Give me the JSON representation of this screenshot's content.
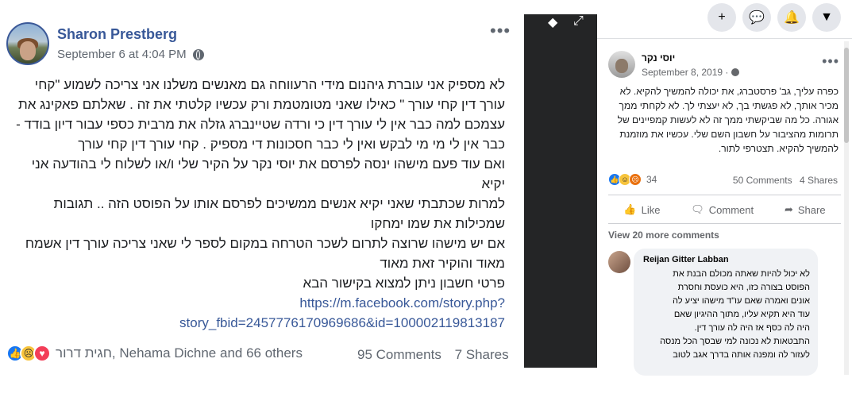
{
  "left_post": {
    "author": "Sharon Prestberg",
    "timestamp": "September 6 at 4:04 PM",
    "more_label": "•••",
    "lines": [
      "לא מספיק אני עוברת גיהנום מידי הרעווחה גם מאנשים משלנו אני צריכה לשמוע \"קחי",
      "עורך דין קחי עורך \" כאילו שאני מטומטמת ורק עכשיו קלטתי את זה . שאלתם פאקינג את",
      "עצמכם למה כבר אין לי עורך דין כי ורדה שטיינברג גזלה את מרבית כספי עבור דיון בודד -",
      "כבר אין לי מי מי לבקש ואין לי כבר חסכונות די מספיק . קחי עורך דין קחי עורך",
      "ואם עוד פעם מישהו ינסה לפרסם את יוסי נקר על הקיר שלי ו/או לשלוח לי בהודעה אני",
      "יקיא",
      "למרות שכתבתי שאני יקיא אנשים ממשיכים לפרסם אותו על הפוסט הזה .. תגובות",
      "שמכילות את שמו ימחקו",
      "אם יש מישהו שרוצה לתרום לשכר הטרחה במקום לספר לי שאני צריכה עורך דין אשמח",
      "מאוד והוקיר זאת מאוד",
      "פרטי חשבון ניתן למצוא בקישור הבא"
    ],
    "link_line1": "https://m.facebook.com/story.php?",
    "link_line2": "story_fbid=2457776170969686&id=100002119813187",
    "reaction_names": "חגית דרור, Nehama Dichne and 66 others",
    "comments": "95 Comments",
    "shares": "7 Shares"
  },
  "top_icons": [
    "plus-icon",
    "messenger-icon",
    "bell-icon",
    "caret-down-icon"
  ],
  "right_post": {
    "author": "יוסי נקר",
    "timestamp": "September 8, 2019 ·",
    "more_label": "•••",
    "lines": [
      "כפרה עליך, גב' פרסטברג, את יכולה להמשיך להקיא. לא",
      "מכיר אותך, לא פגשתי בך, לא יעצתי לך. לא לקחתי ממך",
      "אגורה. כל מה שביקשתי ממך זה לא לעשות קמפיינים של",
      "תרומות מהציבור על חשבון השם שלי. עכשיו את מוזמנת",
      "להמשיך להקיא. תצטרפי לתור."
    ],
    "reaction_count": "34",
    "comments": "50 Comments",
    "shares": "4 Shares",
    "like_label": "Like",
    "comment_label": "Comment",
    "share_label": "Share",
    "view_more": "View 20 more comments"
  },
  "comment": {
    "author": "Reijan Gitter Labban",
    "lines": [
      "לא יכול להיות שאתה מכולם הבנת את",
      "הפוסט בצורה כזו, היא כועסת וחסרת",
      "אונים ואמרה שאם עו\"ד מישהו יציע לה",
      "עוד היא תקיא עליו, מתוך ההיגיון שאם",
      "היה לה כסף אז היה לה עורך דין.",
      "התבטאות לא נכונה למי שבסך הכל מנסה",
      "לעזור לה ומפנה אותה בדרך אגב לטוב"
    ]
  }
}
